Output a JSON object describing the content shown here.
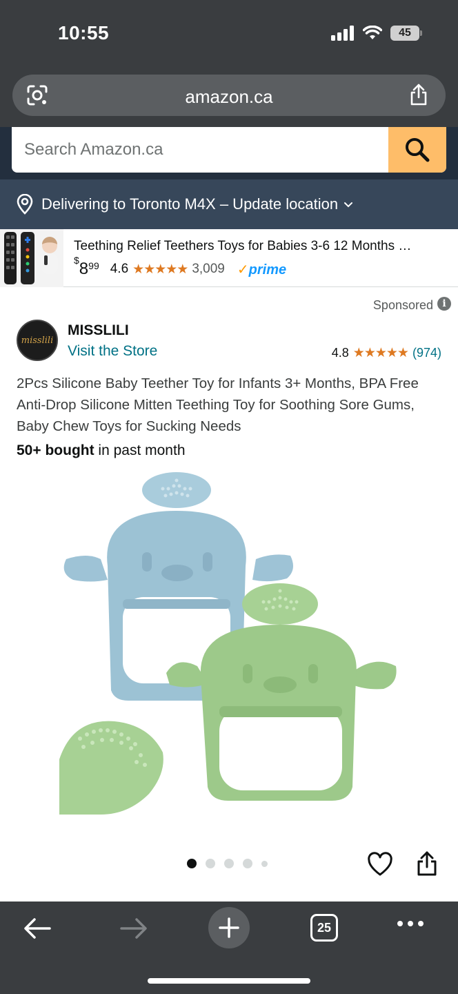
{
  "status_bar": {
    "time": "10:55",
    "battery": "45"
  },
  "browser": {
    "url": "amazon.ca",
    "tab_count": "25"
  },
  "search": {
    "placeholder": "Search Amazon.ca"
  },
  "location": {
    "text": "Delivering to Toronto M4X – Update location"
  },
  "sponsored_strip": {
    "title": "Teething Relief Teethers Toys for Babies 3-6 12 Months …",
    "price_symbol": "$",
    "price_whole": "8",
    "price_fraction": "99",
    "rating": "4.6",
    "stars": "★★★★★",
    "review_count": "3,009",
    "prime_label": "prime"
  },
  "sponsored_label": "Sponsored",
  "brand": {
    "logo_text": "misslili",
    "name": "MISSLILI",
    "store_link": "Visit the Store",
    "rating": "4.8",
    "stars": "★★★★★",
    "review_count": "(974)"
  },
  "product": {
    "title": "2Pcs Silicone Baby Teether Toy for Infants 3+ Months, BPA Free Anti-Drop Silicone Mitten Teething Toy for Soothing Sore Gums, Baby Chew Toys for Sucking Needs",
    "bought_bold": "50+ bought",
    "bought_rest": " in past month",
    "image_alt": "Blue and green chick-shaped silicone teething mittens",
    "image_colors": {
      "blue": "#9cc2d4",
      "green": "#9dc98a"
    }
  },
  "carousel": {
    "total": 5,
    "active": 0
  },
  "colors": {
    "amazon_dark": "#232f3e",
    "location_bar": "#37475a",
    "search_button": "#febd69",
    "link": "#007185",
    "star": "#de7921"
  }
}
